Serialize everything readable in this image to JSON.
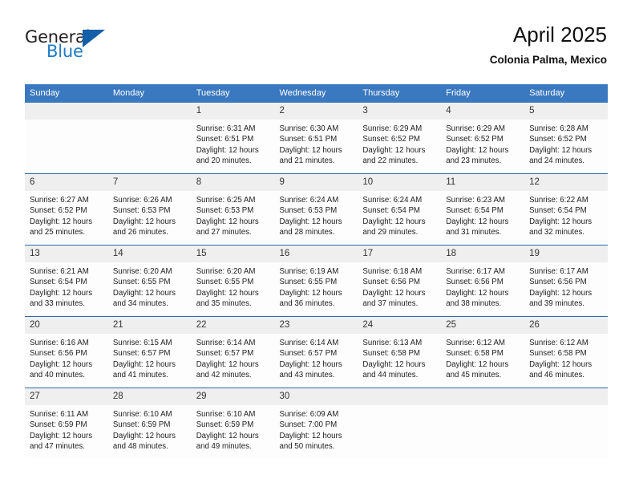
{
  "brand": {
    "name_top": "General",
    "name_bottom": "Blue",
    "triangle_color": "#135fa8",
    "blue_color": "#1e7bc4"
  },
  "header": {
    "title": "April 2025",
    "subtitle": "Colonia Palma, Mexico"
  },
  "theme": {
    "header_blue": "#3a78bf",
    "row_line": "#2d6ca8",
    "daynum_bg": "#efefef",
    "cell_bg": "#fdfdfd"
  },
  "weekdays": [
    "Sunday",
    "Monday",
    "Tuesday",
    "Wednesday",
    "Thursday",
    "Friday",
    "Saturday"
  ],
  "weeks": [
    [
      {
        "day": "",
        "empty": true
      },
      {
        "day": "",
        "empty": true
      },
      {
        "day": "1",
        "sunrise": "Sunrise: 6:31 AM",
        "sunset": "Sunset: 6:51 PM",
        "daylight1": "Daylight: 12 hours",
        "daylight2": "and 20 minutes."
      },
      {
        "day": "2",
        "sunrise": "Sunrise: 6:30 AM",
        "sunset": "Sunset: 6:51 PM",
        "daylight1": "Daylight: 12 hours",
        "daylight2": "and 21 minutes."
      },
      {
        "day": "3",
        "sunrise": "Sunrise: 6:29 AM",
        "sunset": "Sunset: 6:52 PM",
        "daylight1": "Daylight: 12 hours",
        "daylight2": "and 22 minutes."
      },
      {
        "day": "4",
        "sunrise": "Sunrise: 6:29 AM",
        "sunset": "Sunset: 6:52 PM",
        "daylight1": "Daylight: 12 hours",
        "daylight2": "and 23 minutes."
      },
      {
        "day": "5",
        "sunrise": "Sunrise: 6:28 AM",
        "sunset": "Sunset: 6:52 PM",
        "daylight1": "Daylight: 12 hours",
        "daylight2": "and 24 minutes."
      }
    ],
    [
      {
        "day": "6",
        "sunrise": "Sunrise: 6:27 AM",
        "sunset": "Sunset: 6:52 PM",
        "daylight1": "Daylight: 12 hours",
        "daylight2": "and 25 minutes."
      },
      {
        "day": "7",
        "sunrise": "Sunrise: 6:26 AM",
        "sunset": "Sunset: 6:53 PM",
        "daylight1": "Daylight: 12 hours",
        "daylight2": "and 26 minutes."
      },
      {
        "day": "8",
        "sunrise": "Sunrise: 6:25 AM",
        "sunset": "Sunset: 6:53 PM",
        "daylight1": "Daylight: 12 hours",
        "daylight2": "and 27 minutes."
      },
      {
        "day": "9",
        "sunrise": "Sunrise: 6:24 AM",
        "sunset": "Sunset: 6:53 PM",
        "daylight1": "Daylight: 12 hours",
        "daylight2": "and 28 minutes."
      },
      {
        "day": "10",
        "sunrise": "Sunrise: 6:24 AM",
        "sunset": "Sunset: 6:54 PM",
        "daylight1": "Daylight: 12 hours",
        "daylight2": "and 29 minutes."
      },
      {
        "day": "11",
        "sunrise": "Sunrise: 6:23 AM",
        "sunset": "Sunset: 6:54 PM",
        "daylight1": "Daylight: 12 hours",
        "daylight2": "and 31 minutes."
      },
      {
        "day": "12",
        "sunrise": "Sunrise: 6:22 AM",
        "sunset": "Sunset: 6:54 PM",
        "daylight1": "Daylight: 12 hours",
        "daylight2": "and 32 minutes."
      }
    ],
    [
      {
        "day": "13",
        "sunrise": "Sunrise: 6:21 AM",
        "sunset": "Sunset: 6:54 PM",
        "daylight1": "Daylight: 12 hours",
        "daylight2": "and 33 minutes."
      },
      {
        "day": "14",
        "sunrise": "Sunrise: 6:20 AM",
        "sunset": "Sunset: 6:55 PM",
        "daylight1": "Daylight: 12 hours",
        "daylight2": "and 34 minutes."
      },
      {
        "day": "15",
        "sunrise": "Sunrise: 6:20 AM",
        "sunset": "Sunset: 6:55 PM",
        "daylight1": "Daylight: 12 hours",
        "daylight2": "and 35 minutes."
      },
      {
        "day": "16",
        "sunrise": "Sunrise: 6:19 AM",
        "sunset": "Sunset: 6:55 PM",
        "daylight1": "Daylight: 12 hours",
        "daylight2": "and 36 minutes."
      },
      {
        "day": "17",
        "sunrise": "Sunrise: 6:18 AM",
        "sunset": "Sunset: 6:56 PM",
        "daylight1": "Daylight: 12 hours",
        "daylight2": "and 37 minutes."
      },
      {
        "day": "18",
        "sunrise": "Sunrise: 6:17 AM",
        "sunset": "Sunset: 6:56 PM",
        "daylight1": "Daylight: 12 hours",
        "daylight2": "and 38 minutes."
      },
      {
        "day": "19",
        "sunrise": "Sunrise: 6:17 AM",
        "sunset": "Sunset: 6:56 PM",
        "daylight1": "Daylight: 12 hours",
        "daylight2": "and 39 minutes."
      }
    ],
    [
      {
        "day": "20",
        "sunrise": "Sunrise: 6:16 AM",
        "sunset": "Sunset: 6:56 PM",
        "daylight1": "Daylight: 12 hours",
        "daylight2": "and 40 minutes."
      },
      {
        "day": "21",
        "sunrise": "Sunrise: 6:15 AM",
        "sunset": "Sunset: 6:57 PM",
        "daylight1": "Daylight: 12 hours",
        "daylight2": "and 41 minutes."
      },
      {
        "day": "22",
        "sunrise": "Sunrise: 6:14 AM",
        "sunset": "Sunset: 6:57 PM",
        "daylight1": "Daylight: 12 hours",
        "daylight2": "and 42 minutes."
      },
      {
        "day": "23",
        "sunrise": "Sunrise: 6:14 AM",
        "sunset": "Sunset: 6:57 PM",
        "daylight1": "Daylight: 12 hours",
        "daylight2": "and 43 minutes."
      },
      {
        "day": "24",
        "sunrise": "Sunrise: 6:13 AM",
        "sunset": "Sunset: 6:58 PM",
        "daylight1": "Daylight: 12 hours",
        "daylight2": "and 44 minutes."
      },
      {
        "day": "25",
        "sunrise": "Sunrise: 6:12 AM",
        "sunset": "Sunset: 6:58 PM",
        "daylight1": "Daylight: 12 hours",
        "daylight2": "and 45 minutes."
      },
      {
        "day": "26",
        "sunrise": "Sunrise: 6:12 AM",
        "sunset": "Sunset: 6:58 PM",
        "daylight1": "Daylight: 12 hours",
        "daylight2": "and 46 minutes."
      }
    ],
    [
      {
        "day": "27",
        "sunrise": "Sunrise: 6:11 AM",
        "sunset": "Sunset: 6:59 PM",
        "daylight1": "Daylight: 12 hours",
        "daylight2": "and 47 minutes."
      },
      {
        "day": "28",
        "sunrise": "Sunrise: 6:10 AM",
        "sunset": "Sunset: 6:59 PM",
        "daylight1": "Daylight: 12 hours",
        "daylight2": "and 48 minutes."
      },
      {
        "day": "29",
        "sunrise": "Sunrise: 6:10 AM",
        "sunset": "Sunset: 6:59 PM",
        "daylight1": "Daylight: 12 hours",
        "daylight2": "and 49 minutes."
      },
      {
        "day": "30",
        "sunrise": "Sunrise: 6:09 AM",
        "sunset": "Sunset: 7:00 PM",
        "daylight1": "Daylight: 12 hours",
        "daylight2": "and 50 minutes."
      },
      {
        "day": "",
        "empty": true
      },
      {
        "day": "",
        "empty": true
      },
      {
        "day": "",
        "empty": true
      }
    ]
  ]
}
